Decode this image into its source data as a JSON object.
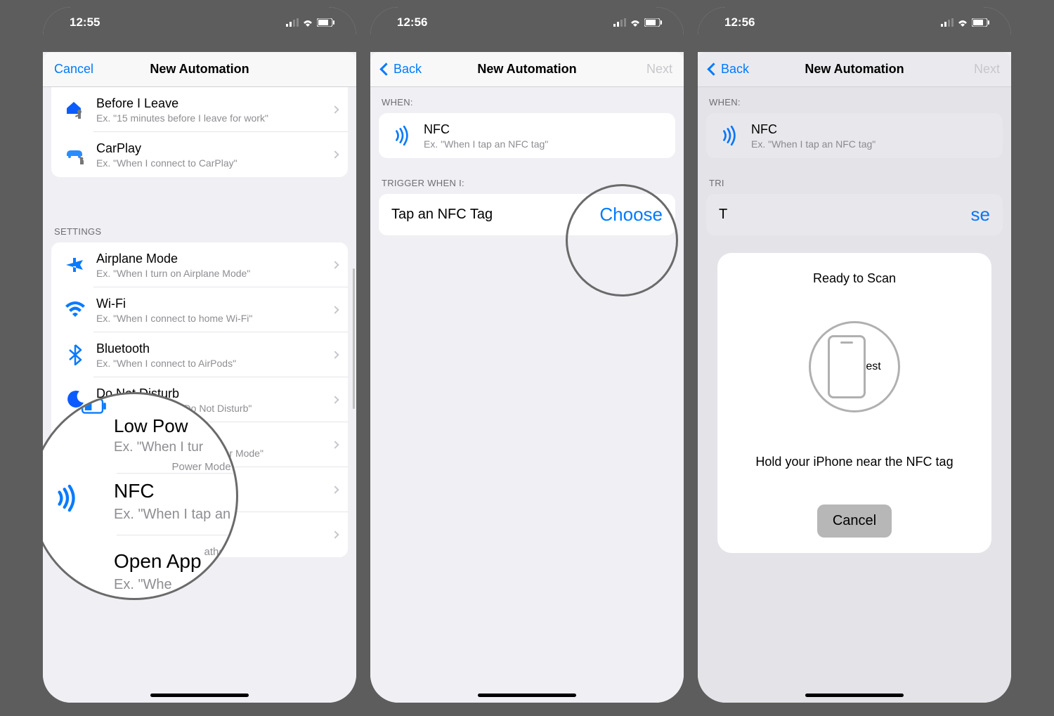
{
  "phone1": {
    "status_time": "12:55",
    "nav": {
      "left": "Cancel",
      "title": "New Automation"
    },
    "top_items": [
      {
        "icon": "home-leave-icon",
        "title": "Before I Leave",
        "sub": "Ex. \"15 minutes before I leave for work\""
      },
      {
        "icon": "carplay-icon",
        "title": "CarPlay",
        "sub": "Ex. \"When I connect to CarPlay\""
      }
    ],
    "settings_header": "SETTINGS",
    "settings_items": [
      {
        "icon": "airplane-icon",
        "title": "Airplane Mode",
        "sub": "Ex. \"When I turn on Airplane Mode\""
      },
      {
        "icon": "wifi-icon",
        "title": "Wi-Fi",
        "sub": "Ex. \"When I connect to home Wi-Fi\""
      },
      {
        "icon": "bluetooth-icon",
        "title": "Bluetooth",
        "sub": "Ex. \"When I connect to AirPods\""
      },
      {
        "icon": "dnd-icon",
        "title": "Do Not Disturb",
        "sub": "Ex. \"When I turn off Do Not Disturb\""
      },
      {
        "icon": "lowpower-icon",
        "title": "Low Power Mode",
        "sub": "Ex. \"When I turn on Low Power Mode\""
      },
      {
        "icon": "nfc-icon",
        "title": "NFC",
        "sub": "Ex. \"When I tap an NFC tag\""
      },
      {
        "icon": "openapp-icon",
        "title": "Open App",
        "sub": "Ex. \"When I open Weather\""
      }
    ],
    "zoom": {
      "lowpower_title": "Low Pow",
      "lowpower_sub_a": "Ex. \"When I tur",
      "lowpower_sub_b": "Power Mode\"",
      "nfc_title": "NFC",
      "nfc_sub": "Ex. \"When I tap an",
      "openapp_title": "Open App",
      "openapp_sub_a": "Ex. \"Whe",
      "openapp_sub_b": "ather\""
    }
  },
  "phone2": {
    "status_time": "12:56",
    "nav": {
      "left": "Back",
      "title": "New Automation",
      "right": "Next"
    },
    "when_header": "WHEN:",
    "nfc_title": "NFC",
    "nfc_sub": "Ex. \"When I tap an NFC tag\"",
    "trigger_header": "TRIGGER WHEN I:",
    "tap_label": "Tap an NFC Tag",
    "choose_label": "Choose"
  },
  "phone3": {
    "status_time": "12:56",
    "nav": {
      "left": "Back",
      "title": "New Automation",
      "right": "Next"
    },
    "when_header": "WHEN:",
    "nfc_title": "NFC",
    "nfc_sub": "Ex. \"When I tap an NFC tag\"",
    "trigger_header": "TRI",
    "tap_label": "T",
    "choose_label": "se",
    "sheet": {
      "title": "Ready to Scan",
      "message": "Hold your iPhone near the NFC tag",
      "cancel": "Cancel"
    }
  }
}
